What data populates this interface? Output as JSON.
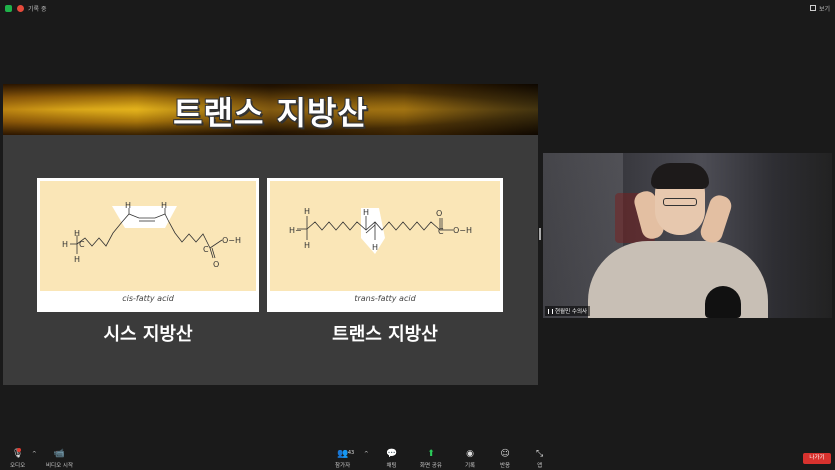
{
  "topbar": {
    "recording_label": "기록 중",
    "view_label": "보기"
  },
  "slide": {
    "title": "트랜스 지방산",
    "cis_caption": "cis-fatty acid",
    "trans_caption": "trans-fatty acid",
    "cis_label": "시스 지방산",
    "trans_label": "트랜스 지방산"
  },
  "video": {
    "participant_name": "현월민 수의사"
  },
  "toolbar": {
    "audio_label": "오디오",
    "video_label": "비디오 시작",
    "participants_label": "참가자",
    "participants_count": "43",
    "chat_label": "채팅",
    "share_label": "화면 공유",
    "record_label": "기록",
    "reactions_label": "반응",
    "apps_label": "앱",
    "leave_label": "나가기"
  },
  "colors": {
    "accent_green": "#2bcc5a",
    "leave_red": "#d8322e",
    "slide_bg": "#3b3b3b",
    "panel": "#fae6b7"
  },
  "icons": [
    "shield-icon",
    "record-icon",
    "view-icon",
    "microphone-icon",
    "video-camera-icon",
    "participants-icon",
    "chat-icon",
    "share-screen-icon",
    "record-circle-icon",
    "reaction-icon",
    "apps-icon"
  ]
}
